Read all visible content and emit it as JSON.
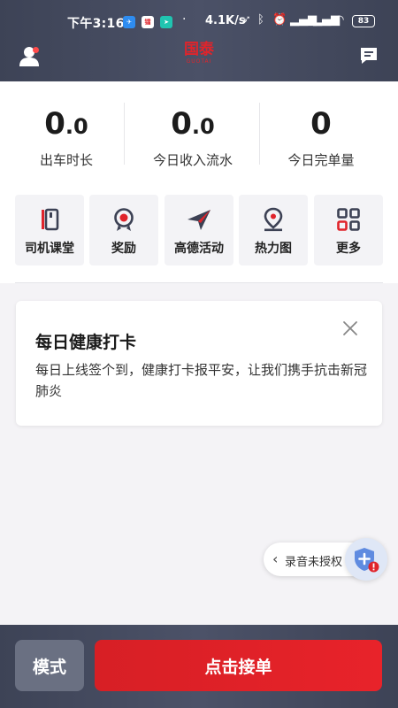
{
  "status_bar": {
    "time": "下午3:16",
    "app_badge": "镭",
    "network_speed": "4.1K/s",
    "battery": "83"
  },
  "header": {
    "logo_main": "国泰",
    "logo_sub": "GUOTAI"
  },
  "stats": [
    {
      "value_int": "0",
      "value_frac": ".0",
      "label": "出车时长"
    },
    {
      "value_int": "0",
      "value_frac": ".0",
      "label": "今日收入流水"
    },
    {
      "value_int": "0",
      "value_frac": "",
      "label": "今日完单量"
    }
  ],
  "quick_actions": [
    {
      "label": "司机课堂",
      "icon": "book-icon"
    },
    {
      "label": "奖励",
      "icon": "medal-icon"
    },
    {
      "label": "高德活动",
      "icon": "paper-plane-icon"
    },
    {
      "label": "热力图",
      "icon": "map-pin-icon"
    },
    {
      "label": "更多",
      "icon": "grid-icon"
    }
  ],
  "notice_card": {
    "title": "每日健康打卡",
    "body": "每日上线签个到，健康打卡报平安，让我们携手抗击新冠肺炎"
  },
  "permission": {
    "label": "录音未授权"
  },
  "bottom_bar": {
    "mode_label": "模式",
    "accept_label": "点击接单"
  },
  "colors": {
    "header_bg": "#444a5e",
    "accent_red": "#e0242b",
    "icon_dark": "#3c4154"
  }
}
